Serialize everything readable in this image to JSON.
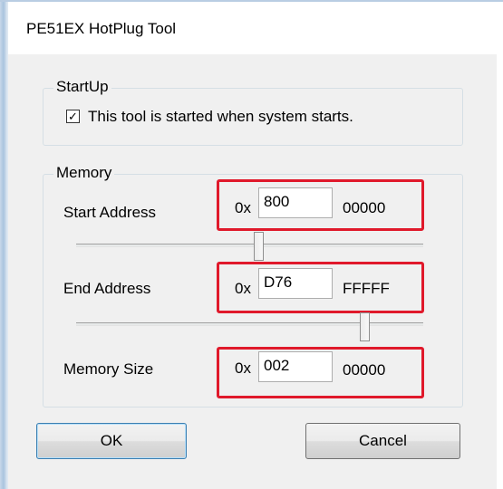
{
  "window": {
    "title": "PE51EX HotPlug Tool"
  },
  "startup": {
    "group_label": "StartUp",
    "checkbox_checked": true,
    "checkbox_mark": "✓",
    "checkbox_label": "This tool is started when system starts."
  },
  "memory": {
    "group_label": "Memory",
    "rows": [
      {
        "label": "Start Address",
        "prefix": "0x",
        "value": "800",
        "suffix": "00000",
        "slider_level": 0.52
      },
      {
        "label": "End Address",
        "prefix": "0x",
        "value": "D76",
        "suffix": "FFFFF",
        "slider_level": 0.84
      },
      {
        "label": "Memory Size",
        "prefix": "0x",
        "value": "002",
        "suffix": "00000"
      }
    ]
  },
  "buttons": {
    "ok": "OK",
    "cancel": "Cancel"
  },
  "colors": {
    "highlight": "#e0192b",
    "dialog_bg": "#f0f0f0"
  }
}
